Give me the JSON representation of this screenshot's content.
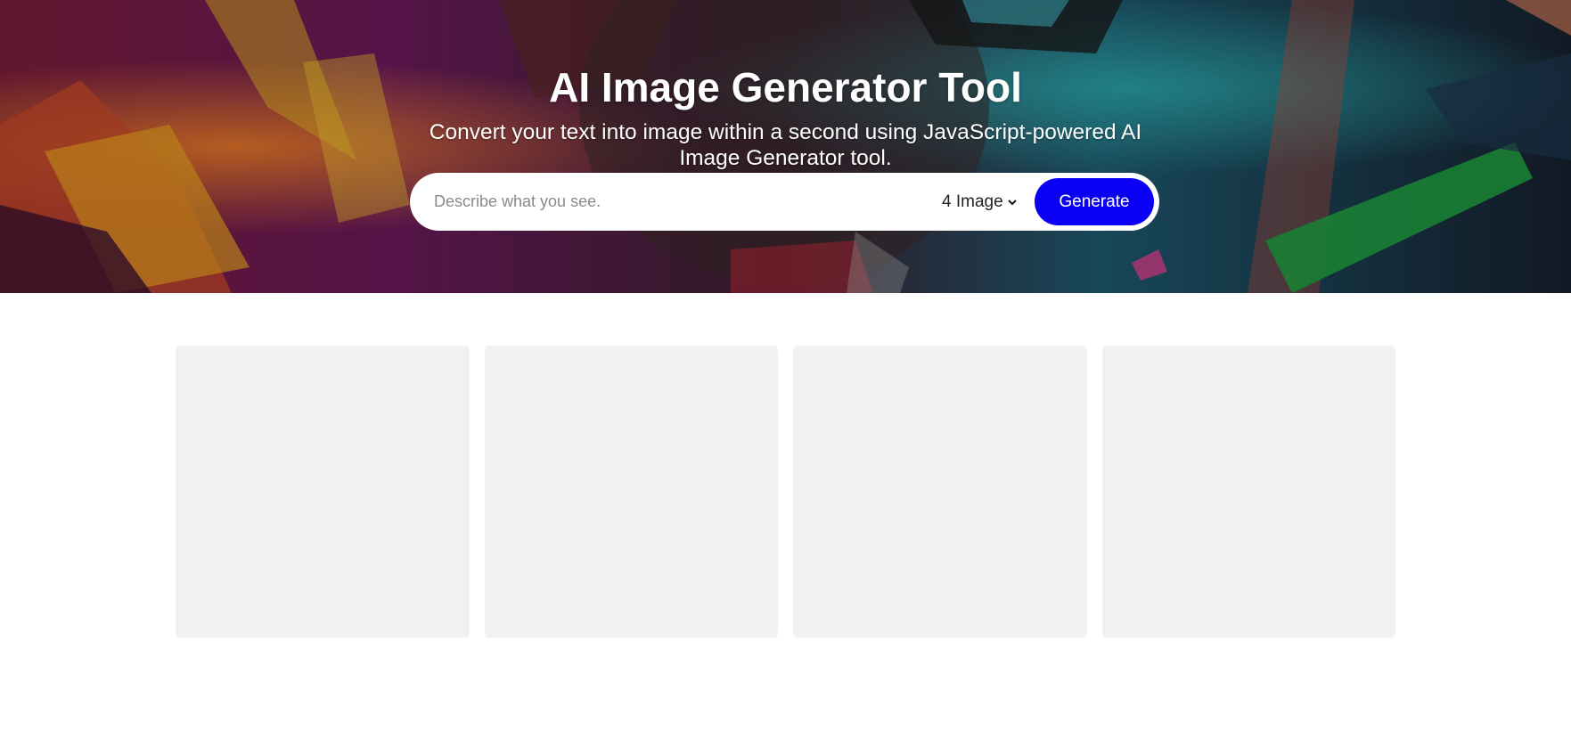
{
  "hero": {
    "title": "AI Image Generator Tool",
    "subtitle": "Convert your text into image within a second using JavaScript-powered AI Image Generator tool."
  },
  "form": {
    "placeholder": "Describe what you see.",
    "quantity_selected": "4 Image",
    "generate_label": "Generate"
  },
  "gallery": {
    "cards": [
      "",
      "",
      "",
      ""
    ]
  },
  "colors": {
    "accent": "#0a00f4",
    "card_bg": "#f1f1f1"
  }
}
